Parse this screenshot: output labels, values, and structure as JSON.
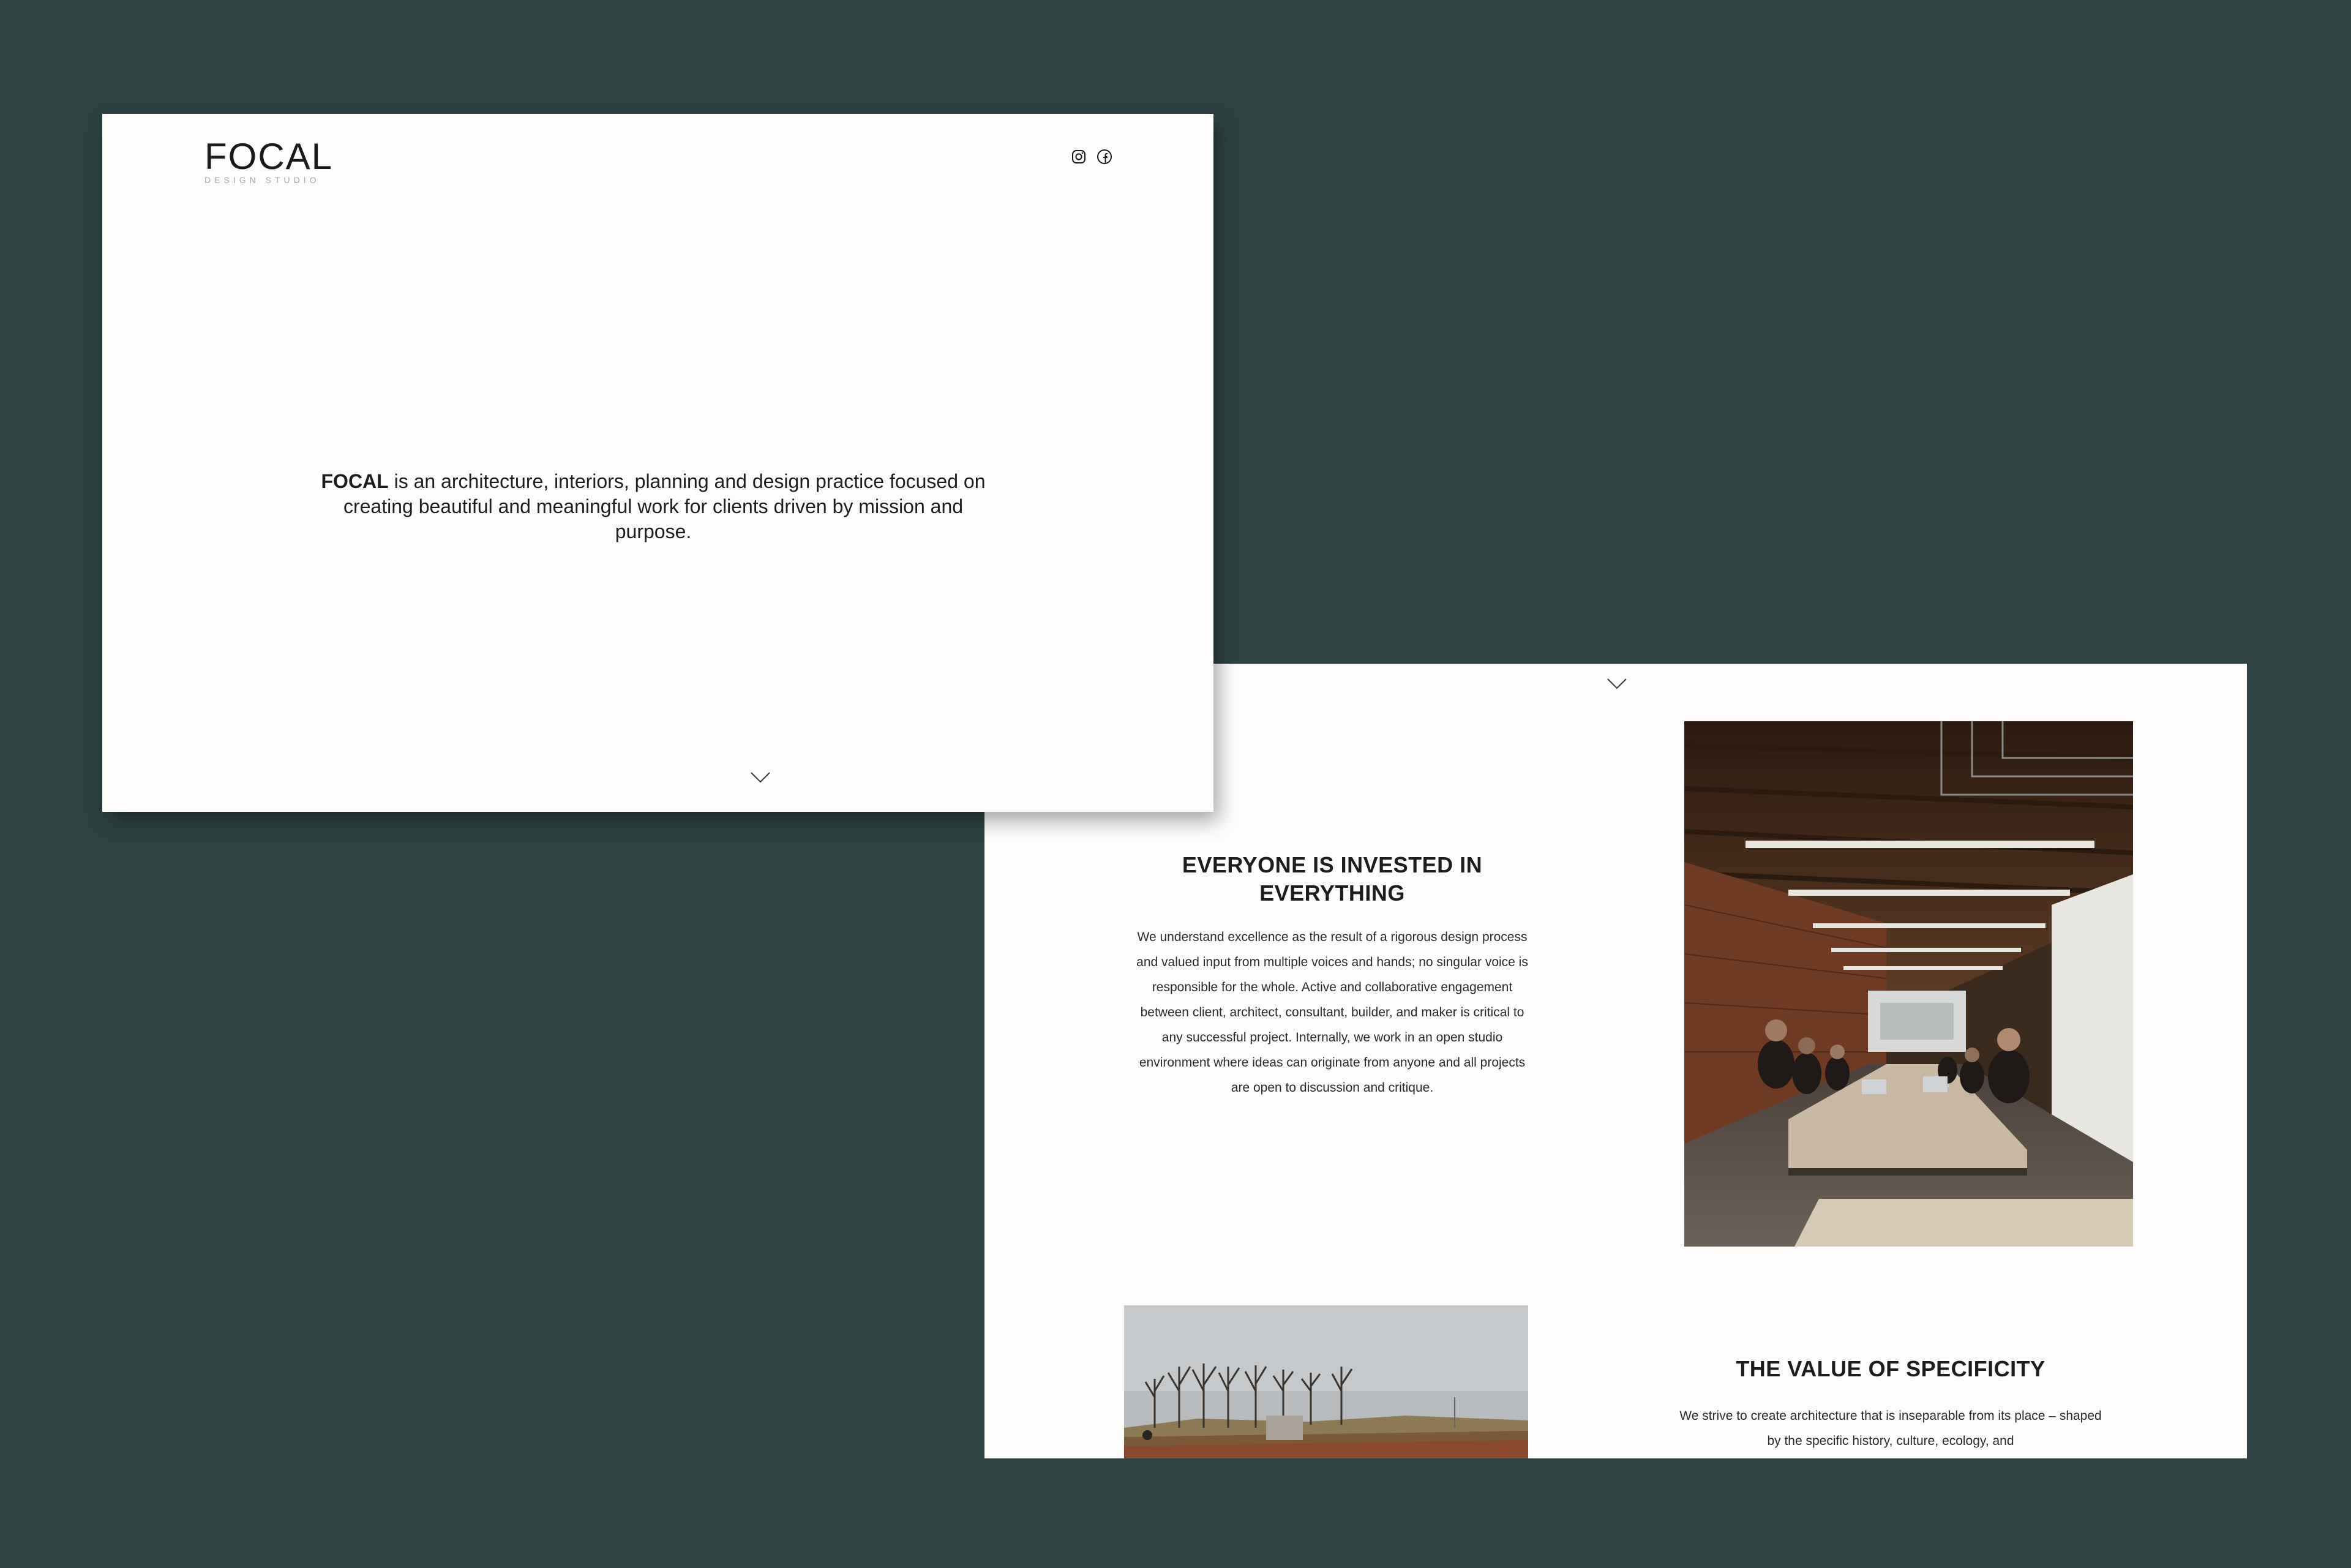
{
  "site": {
    "logo": {
      "word": "FOCAL",
      "subtitle": "DESIGN STUDIO"
    },
    "social_icons": [
      "instagram-icon",
      "facebook-icon"
    ]
  },
  "hero": {
    "brand": "FOCAL",
    "intro_rest": " is an architecture, interiors, planning and design practice focused on creating beautiful and meaningful work for clients driven by mission and purpose."
  },
  "sections": [
    {
      "title": "EVERYONE IS INVESTED IN EVERYTHING",
      "body": "We understand excellence as the result of a rigorous design process and valued input from multiple voices and hands; no singular voice is responsible for the whole. Active and collaborative engagement between client, architect, consultant, builder, and maker is critical to any successful project. Internally, we work in an open studio environment where ideas can originate from anyone and all projects are open to discussion and critique."
    },
    {
      "title": "THE VALUE OF SPECIFICITY",
      "body": "We strive to create architecture that is inseparable from its place – shaped by the specific history, culture, ecology, and"
    }
  ],
  "colors": {
    "background": "#2d4241",
    "page": "#fdfcfa",
    "text": "#1d1d1d"
  }
}
